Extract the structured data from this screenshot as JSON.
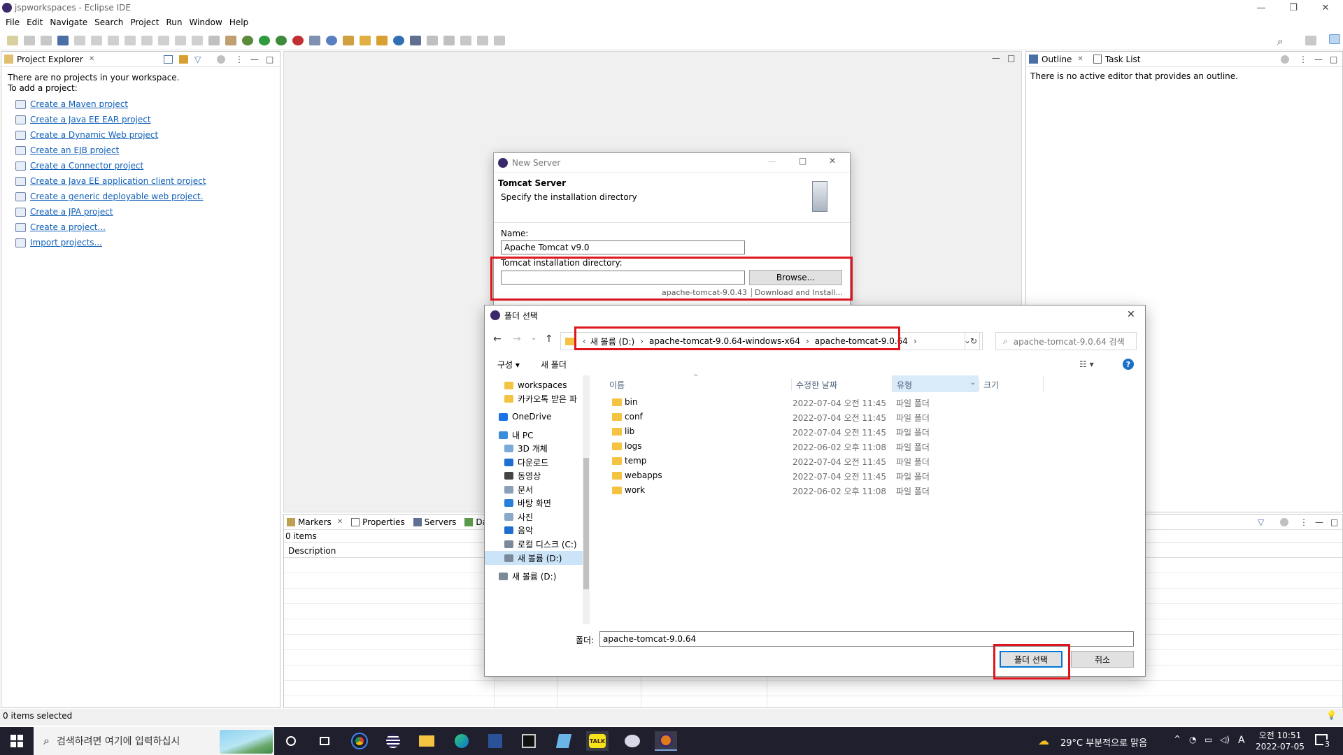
{
  "window": {
    "title": "jspworkspaces - Eclipse IDE"
  },
  "menu": [
    "File",
    "Edit",
    "Navigate",
    "Search",
    "Project",
    "Run",
    "Window",
    "Help"
  ],
  "project_explorer": {
    "tab": "Project Explorer",
    "message1": "There are no projects in your workspace.",
    "message2": "To add a project:",
    "links": [
      "Create a Maven project",
      "Create a Java EE EAR project",
      "Create a Dynamic Web project",
      "Create an EJB project",
      "Create a Connector project",
      "Create a Java EE application client project",
      "Create a generic deployable web project.",
      "Create a JPA project",
      "Create a project...",
      "Import projects..."
    ]
  },
  "outline": {
    "tab1": "Outline",
    "tab2": "Task List",
    "message": "There is no active editor that provides an outline."
  },
  "bottom_panel": {
    "tabs": [
      "Markers",
      "Properties",
      "Servers",
      "Dat"
    ],
    "items": "0 items",
    "column": "Description"
  },
  "status_bar": {
    "text": "0 items selected"
  },
  "new_server": {
    "title": "New Server",
    "heading": "Tomcat Server",
    "subheading": "Specify the installation directory",
    "name_label": "Name:",
    "name_value": "Apache Tomcat v9.0",
    "dir_label": "Tomcat installation directory:",
    "dir_value": "",
    "browse": "Browse...",
    "hidden_text": "apache-tomcat-9.0.43",
    "hidden_button": "Download and Install..."
  },
  "folder_dialog": {
    "title": "폴더 선택",
    "breadcrumb": [
      "새 볼륨 (D:)",
      "apache-tomcat-9.0.64-windows-x64",
      "apache-tomcat-9.0.64"
    ],
    "search_placeholder": "apache-tomcat-9.0.64 검색",
    "organize": "구성",
    "new_folder": "새 폴더",
    "columns": {
      "name": "이름",
      "date": "수정한 날짜",
      "type": "유형",
      "size": "크기"
    },
    "nav": [
      {
        "label": "workspaces",
        "icon": "folder-icon"
      },
      {
        "label": "카카오톡 받은 파",
        "icon": "folder-icon"
      },
      {
        "label": "OneDrive",
        "icon": "cloud-icon"
      },
      {
        "label": "내 PC",
        "icon": "pc-icon"
      },
      {
        "label": "3D 개체",
        "icon": "cube-icon"
      },
      {
        "label": "다운로드",
        "icon": "download-icon"
      },
      {
        "label": "동영상",
        "icon": "video-icon"
      },
      {
        "label": "문서",
        "icon": "document-icon"
      },
      {
        "label": "바탕 화면",
        "icon": "desktop-icon"
      },
      {
        "label": "사진",
        "icon": "picture-icon"
      },
      {
        "label": "음악",
        "icon": "music-icon"
      },
      {
        "label": "로컬 디스크 (C:)",
        "icon": "drive-icon"
      },
      {
        "label": "새 볼륨 (D:)",
        "icon": "drive-icon"
      },
      {
        "label": "새 볼륨 (D:)",
        "icon": "drive-icon"
      }
    ],
    "files": [
      {
        "name": "bin",
        "date": "2022-07-04 오전 11:45",
        "type": "파일 폴더"
      },
      {
        "name": "conf",
        "date": "2022-07-04 오전 11:45",
        "type": "파일 폴더"
      },
      {
        "name": "lib",
        "date": "2022-07-04 오전 11:45",
        "type": "파일 폴더"
      },
      {
        "name": "logs",
        "date": "2022-06-02 오후 11:08",
        "type": "파일 폴더"
      },
      {
        "name": "temp",
        "date": "2022-07-04 오전 11:45",
        "type": "파일 폴더"
      },
      {
        "name": "webapps",
        "date": "2022-07-04 오전 11:45",
        "type": "파일 폴더"
      },
      {
        "name": "work",
        "date": "2022-06-02 오후 11:08",
        "type": "파일 폴더"
      }
    ],
    "folder_label": "폴더:",
    "folder_value": "apache-tomcat-9.0.64",
    "select_button": "폴더 선택",
    "cancel_button": "취소"
  },
  "taskbar": {
    "search_placeholder": "검색하려면 여기에 입력하십시",
    "weather": "29°C  부분적으로 맑음",
    "time": "오전 10:51",
    "date": "2022-07-05",
    "ime": "A",
    "notifications": "3"
  },
  "colors": {
    "highlight_red": "#e0161f",
    "link": "#0f5fb8",
    "taskbar": "#1f1f2e"
  }
}
